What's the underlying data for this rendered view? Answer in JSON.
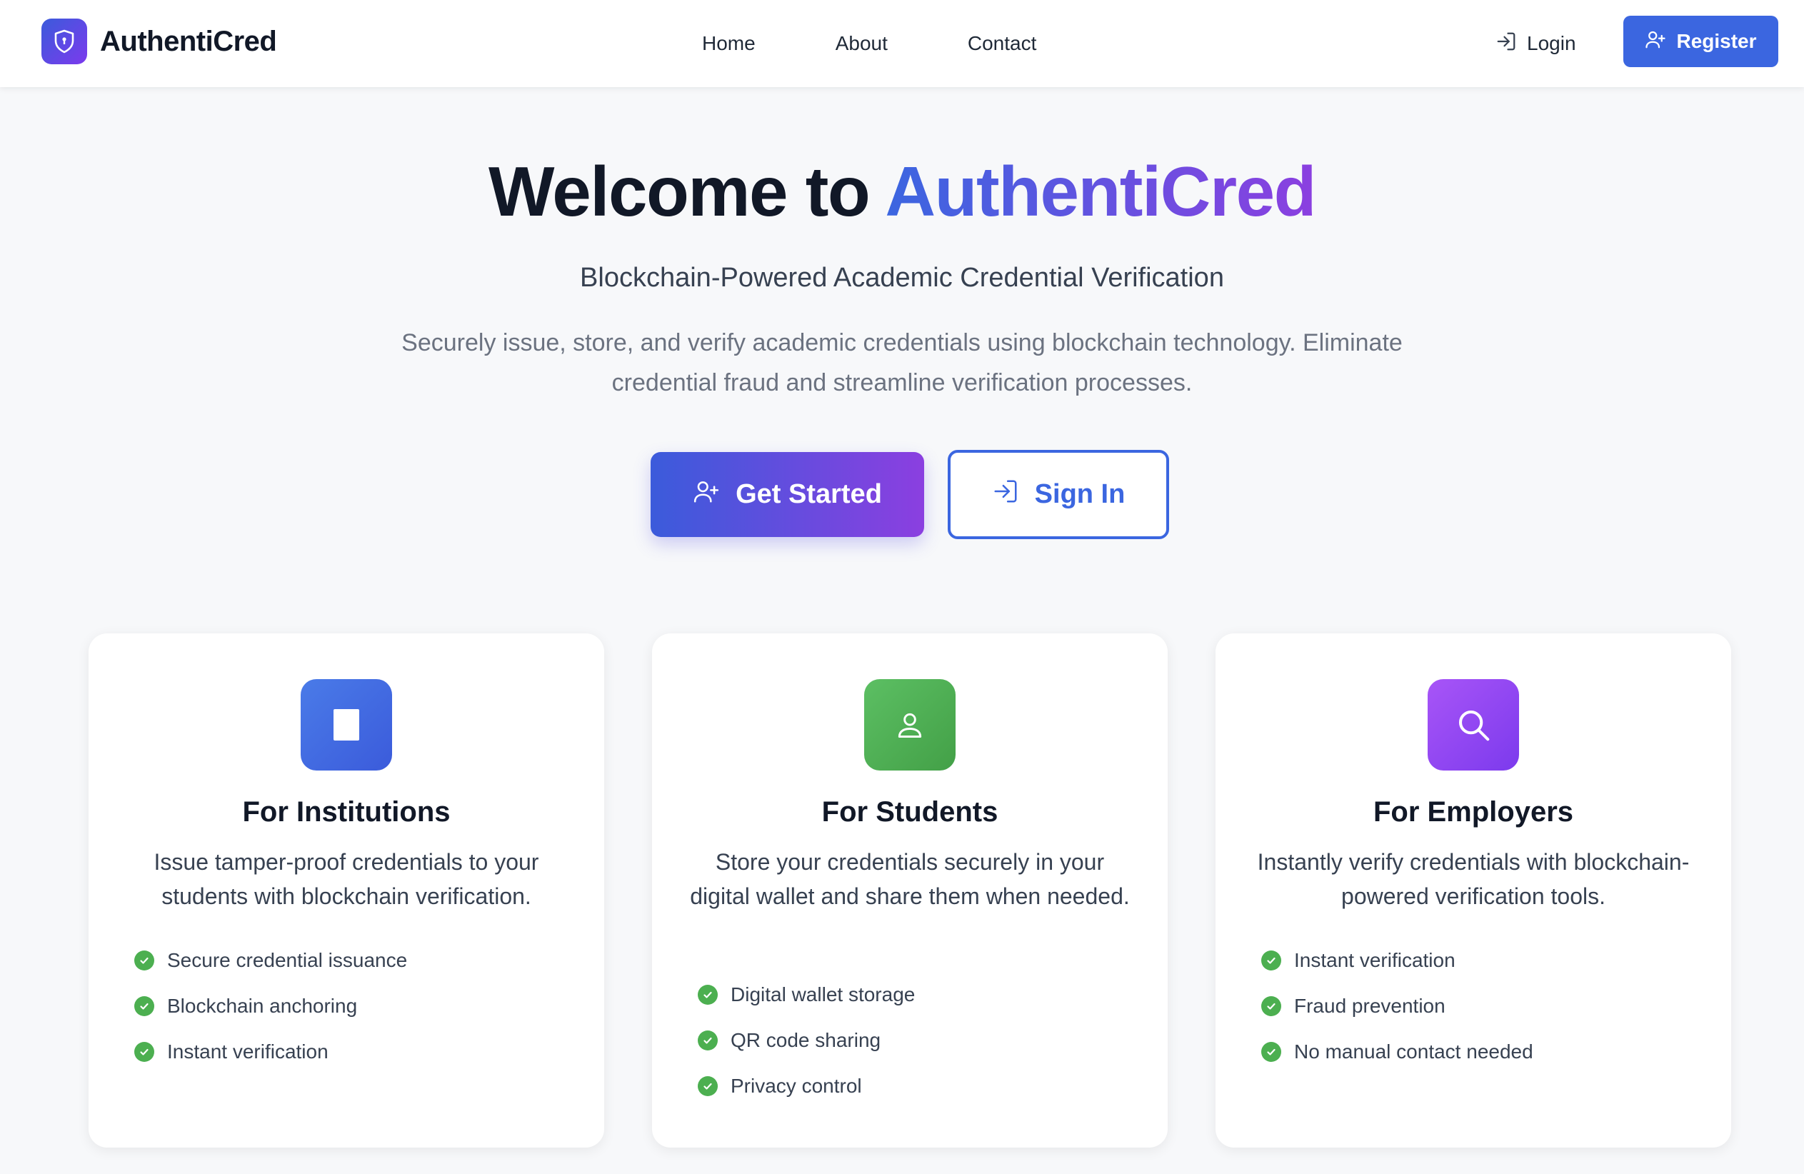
{
  "header": {
    "brand": "AuthentiCred",
    "nav": [
      "Home",
      "About",
      "Contact"
    ],
    "login_label": "Login",
    "register_label": "Register"
  },
  "hero": {
    "title_prefix": "Welcome to ",
    "title_accent": "AuthentiCred",
    "subtitle": "Blockchain-Powered Academic Credential Verification",
    "description": "Securely issue, store, and verify academic credentials using blockchain technology. Eliminate credential fraud and streamline verification processes.",
    "primary_cta": "Get Started",
    "secondary_cta": "Sign In"
  },
  "cards": [
    {
      "title": "For Institutions",
      "description": "Issue tamper-proof credentials to your students with blockchain verification.",
      "icon": "document-icon",
      "color": "#3b66e0",
      "features": [
        "Secure credential issuance",
        "Blockchain anchoring",
        "Instant verification"
      ]
    },
    {
      "title": "For Students",
      "description": "Store your credentials securely in your digital wallet and share them when needed.",
      "icon": "user-icon",
      "color": "#4caf50",
      "features": [
        "Digital wallet storage",
        "QR code sharing",
        "Privacy control"
      ]
    },
    {
      "title": "For Employers",
      "description": "Instantly verify credentials with blockchain-powered verification tools.",
      "icon": "search-icon",
      "color": "#8b3fe0",
      "features": [
        "Instant verification",
        "Fraud prevention",
        "No manual contact needed"
      ]
    }
  ],
  "colors": {
    "primary": "#3b66e0",
    "accent_purple": "#8b3fe0",
    "success": "#4caf50"
  }
}
